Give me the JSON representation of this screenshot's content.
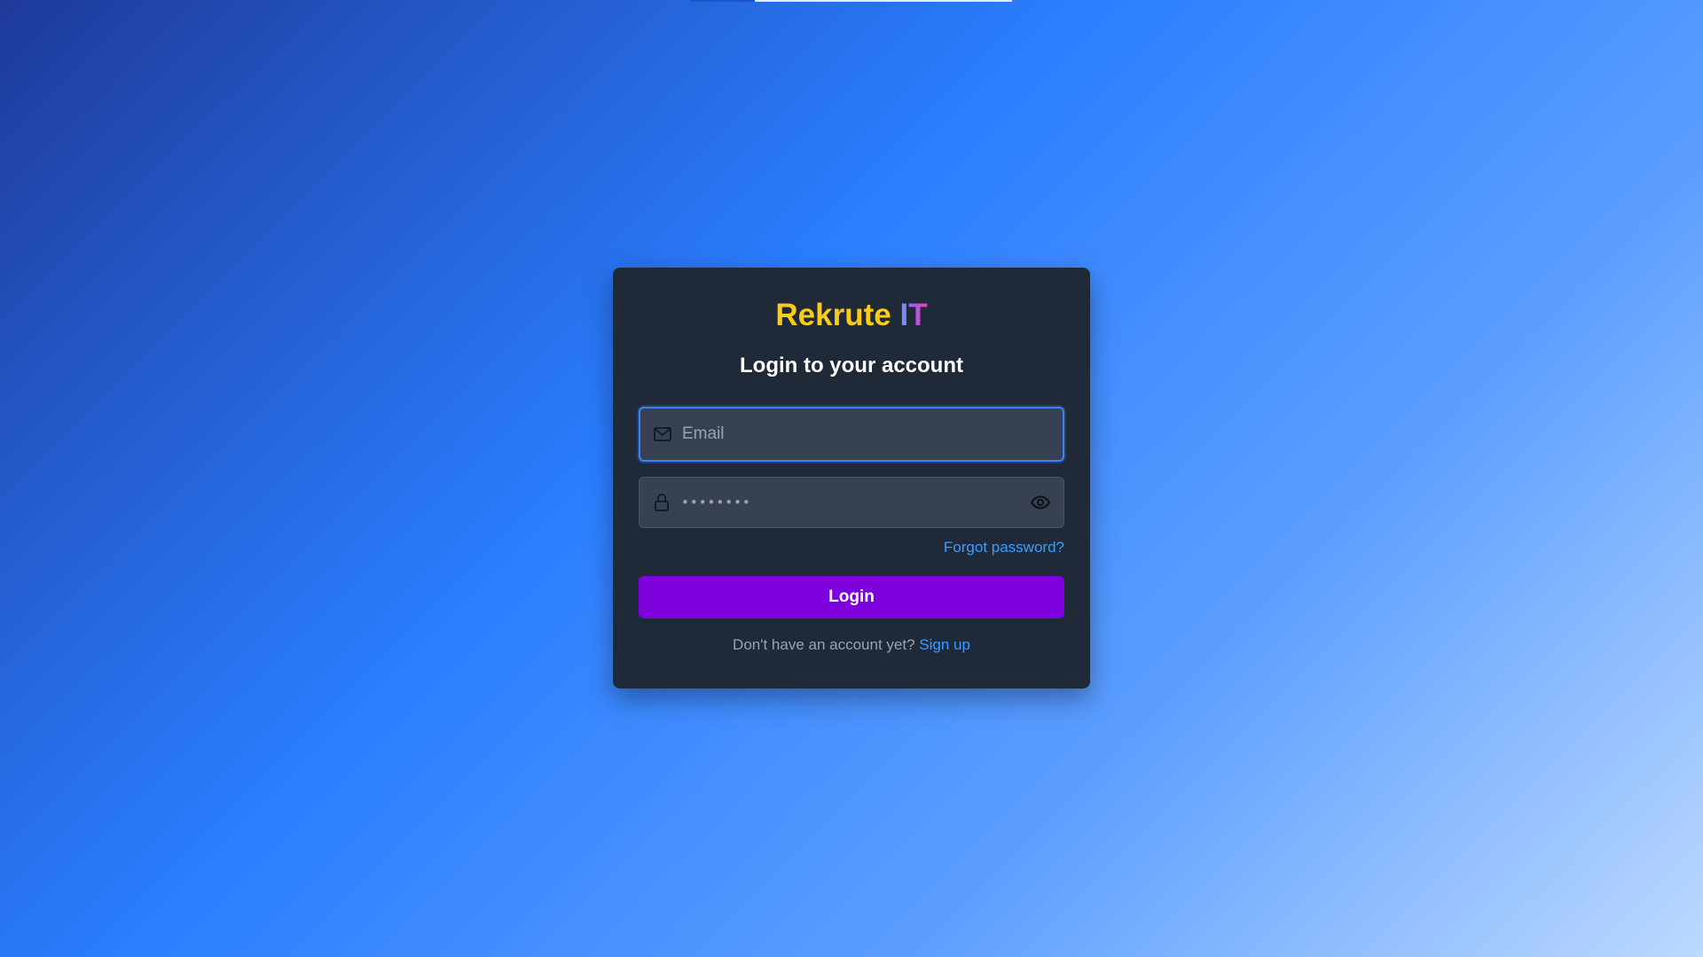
{
  "page": {
    "progress_fraction": 0.2
  },
  "brand": {
    "name_main": "Rekrute",
    "name_accent": "IT"
  },
  "form": {
    "heading": "Login to your account",
    "email": {
      "placeholder": "Email",
      "value": "",
      "icon": "mail-icon"
    },
    "password": {
      "masked_value": "••••••••",
      "icon": "lock-icon",
      "toggle_icon": "eye-icon"
    },
    "forgot_password_label": "Forgot password?",
    "login_button_label": "Login",
    "signup_prompt": "Don't have an account yet?",
    "signup_link_label": "Sign up"
  },
  "colors": {
    "brand_main": "#facc15",
    "card_background": "#1f2937",
    "primary_button": "#7e00dd",
    "link": "#3b9dff",
    "focus_border": "#3b82f6"
  }
}
